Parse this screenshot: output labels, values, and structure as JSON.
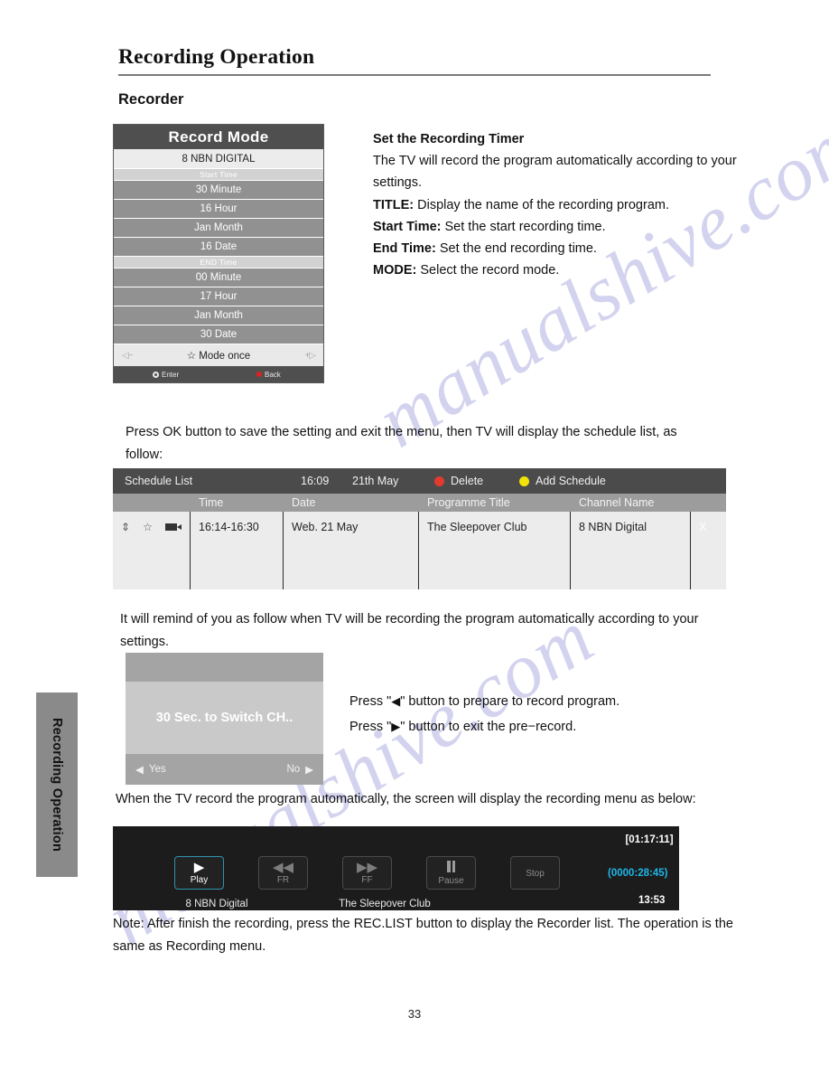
{
  "document": {
    "chapter_title": "Recording Operation",
    "section_title": "Recorder",
    "side_tab_label": "Recording Operation",
    "page_number": "33",
    "watermark_text": "manualshive.com"
  },
  "record_mode_menu": {
    "title": "Record Mode",
    "channel": "8 NBN DIGITAL",
    "start_time_label": "Start Time",
    "end_time_label": "END Time",
    "start_rows": [
      "30  Minute",
      "16 Hour",
      "Jan  Month",
      "16 Date"
    ],
    "end_rows": [
      "00 Minute",
      "17 Hour",
      "Jan  Month",
      "30 Date"
    ],
    "mode_row": {
      "left_arrow": "◁−",
      "label": "☆ Mode  once",
      "right_arrow": "+▷"
    },
    "footer": {
      "enter_label": "Enter",
      "back_label": "Back"
    }
  },
  "timer_info": {
    "heading": "Set the Recording Timer",
    "intro": "The TV will record the program automatically according to your settings.",
    "items": [
      {
        "label": "TITLE:",
        "text": " Display the name of the recording program."
      },
      {
        "label": "Start Time:",
        "text": " Set the start recording time."
      },
      {
        "label": "End Time:",
        "text": " Set the end recording time."
      },
      {
        "label": "MODE:",
        "text": " Select the record mode."
      }
    ]
  },
  "paragraphs": {
    "press_ok": "Press OK button to save the setting and exit the menu, then TV will display the schedule list, as follow:",
    "remind": "It will remind of you as follow when TV will be recording the program automatically according to your settings.",
    "when_record": "When the TV record the program automatically, the screen  will  display  the  recording menu  as below:",
    "note": "Note: After finish the recording, press the REC.LIST button to display the Recorder list. The operation is the  same  as Recording menu."
  },
  "schedule_list": {
    "title": "Schedule List",
    "time": "16:09",
    "date": "21th May",
    "delete_label": "Delete",
    "add_label": "Add Schedule",
    "columns": [
      "",
      "Time",
      "Date",
      "Programme Title",
      "Channel Name",
      ""
    ],
    "rows": [
      {
        "icons": "",
        "time": "16:14-16:30",
        "date": "Web. 21 May",
        "programme": "The Sleepover Club",
        "channel": "8 NBN Digital",
        "close": "X"
      }
    ]
  },
  "switch_dialog": {
    "message": "30 Sec. to Switch CH..",
    "yes_label": "Yes",
    "no_label": "No"
  },
  "press_instructions": {
    "line1_pre": "Press \"",
    "line1_arrow": "◀",
    "line1_post": "\"  button to prepare to record program.",
    "line2_pre": "Press \"",
    "line2_arrow": "▶",
    "line2_post": "\" button to exit the pre−record."
  },
  "playback_bar": {
    "timecode_total": "[01:17:11]",
    "buttons": [
      {
        "glyph": "▶",
        "caption": "Play",
        "active": true
      },
      {
        "glyph": "◀◀",
        "caption": "FR",
        "active": false
      },
      {
        "glyph": "▶▶",
        "caption": "FF",
        "active": false
      },
      {
        "glyph": "",
        "caption": "Pause",
        "active": false
      },
      {
        "glyph": "",
        "caption": "Stop",
        "active": false
      }
    ],
    "channel": "8 NBN Digital",
    "programme": "The Sleepover Club",
    "elapsed": "(0000:28:45)",
    "clock": "13:53",
    "accent_color": "#2f93ad",
    "elapsed_color": "#1fb6e8"
  }
}
